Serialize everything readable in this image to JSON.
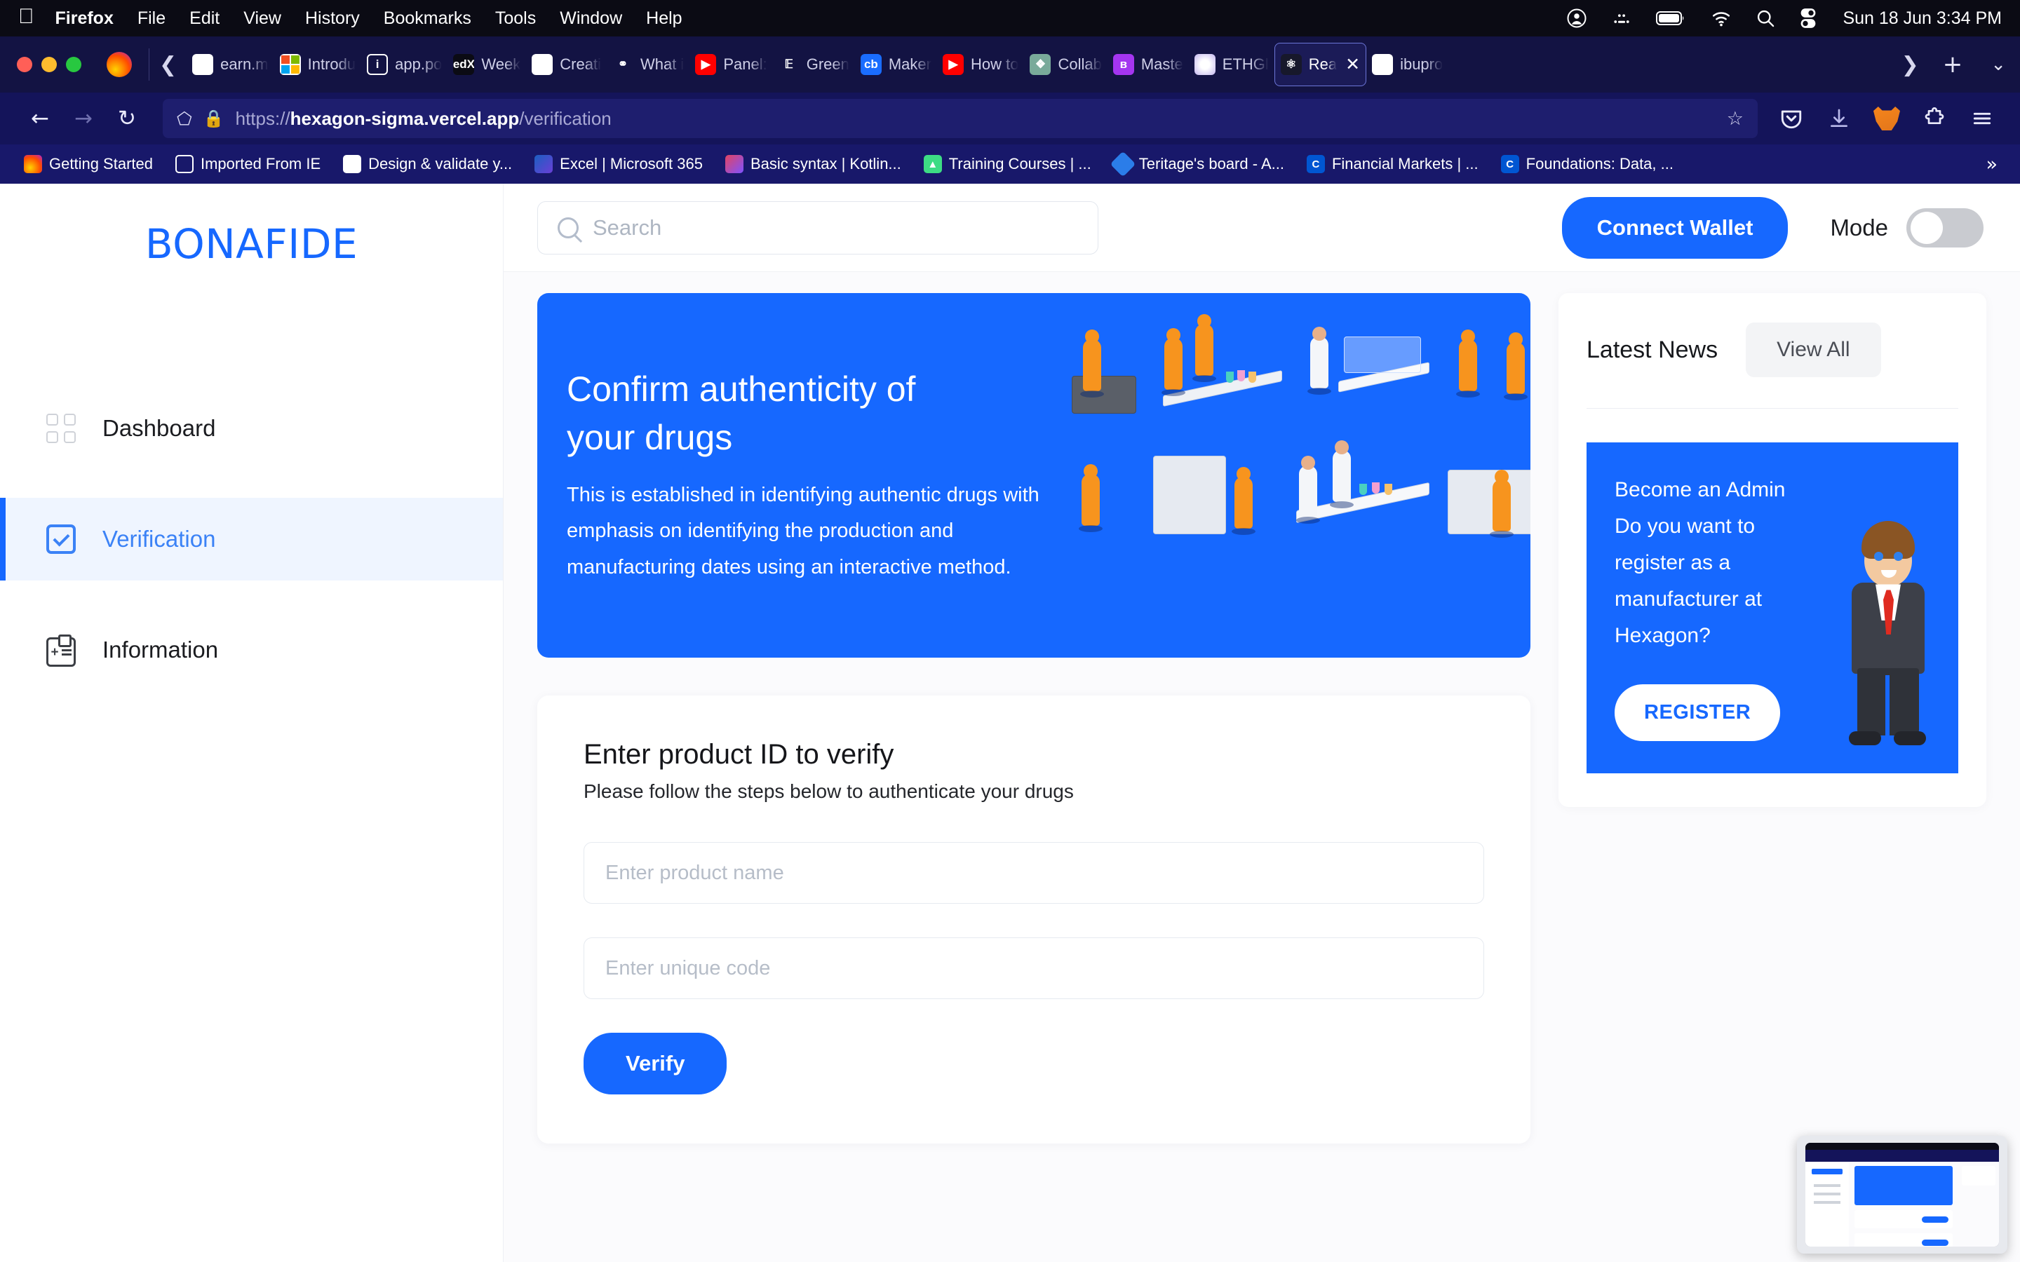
{
  "menubar": {
    "apple_icon": "apple-icon",
    "items": [
      "Firefox",
      "File",
      "Edit",
      "View",
      "History",
      "Bookmarks",
      "Tools",
      "Window",
      "Help"
    ],
    "status_icons": [
      "control-center-user-icon",
      "bluetooth-dots-icon",
      "battery-icon",
      "wifi-icon",
      "search-icon",
      "control-center-icon"
    ],
    "clock": "Sun 18 Jun  3:34 PM"
  },
  "browser": {
    "tabs": [
      {
        "label": "earn.m",
        "favicon": "generic-icon",
        "active": false
      },
      {
        "label": "Introdu",
        "favicon": "microsoft-icon",
        "active": false
      },
      {
        "label": "app.po",
        "favicon": "info-icon",
        "active": false
      },
      {
        "label": "Week",
        "favicon": "edx-icon",
        "active": false
      },
      {
        "label": "Creati",
        "favicon": "zoom-z-icon",
        "active": false
      },
      {
        "label": "What i",
        "favicon": "spiral-icon",
        "active": false
      },
      {
        "label": "Panel:",
        "favicon": "youtube-icon",
        "active": false
      },
      {
        "label": "Green",
        "favicon": "green-g-icon",
        "active": false
      },
      {
        "label": "Maker",
        "favicon": "cb-icon",
        "active": false
      },
      {
        "label": "How to",
        "favicon": "youtube-icon",
        "active": false
      },
      {
        "label": "Collab",
        "favicon": "openai-icon",
        "active": false
      },
      {
        "label": "Maste",
        "favicon": "udemy-icon",
        "active": false
      },
      {
        "label": "ETHGl",
        "favicon": "ethglobal-icon",
        "active": false
      },
      {
        "label": "Rea",
        "favicon": "react-icon",
        "active": true
      },
      {
        "label": "ibupro",
        "favicon": "google-icon",
        "active": false
      }
    ],
    "tab_scroll_left_icon": "chevron-left-icon",
    "tab_scroll_right_icon": "chevron-right-icon",
    "new_tab_icon": "plus-icon",
    "list_all_tabs_icon": "chevron-down-icon",
    "close_tab_icon": "close-icon",
    "nav": {
      "back_icon": "back-arrow-icon",
      "forward_icon": "forward-arrow-icon",
      "reload_icon": "reload-icon",
      "shield_icon": "shield-icon",
      "lock_icon": "padlock-icon",
      "bookmark_star_icon": "star-icon",
      "url_scheme": "https://",
      "url_host": "hexagon-sigma.vercel.app",
      "url_path": "/verification"
    },
    "toolbar_icons": [
      "pocket-icon",
      "downloads-icon",
      "metamask-icon",
      "extensions-icon",
      "hamburger-menu-icon"
    ],
    "bookmarks": [
      {
        "label": "Getting Started",
        "icon": "firefox-icon"
      },
      {
        "label": "Imported From IE",
        "icon": "folder-icon"
      },
      {
        "label": "Design & validate y...",
        "icon": "grammarly-icon"
      },
      {
        "label": "Excel | Microsoft 365",
        "icon": "excel-icon"
      },
      {
        "label": "Basic syntax | Kotlin...",
        "icon": "kotlin-icon"
      },
      {
        "label": "Training Courses  |  ...",
        "icon": "android-icon"
      },
      {
        "label": "Teritage's board - A...",
        "icon": "teritage-icon"
      },
      {
        "label": "Financial Markets | ...",
        "icon": "coursera-icon"
      },
      {
        "label": "Foundations: Data, ...",
        "icon": "coursera-icon"
      }
    ],
    "bookmarks_overflow_icon": "double-chevron-right-icon"
  },
  "app": {
    "logo": "BONAFIDE",
    "sidebar": {
      "items": [
        {
          "label": "Dashboard",
          "icon": "grid-icon",
          "active": false
        },
        {
          "label": "Verification",
          "icon": "checkbox-icon",
          "active": true
        },
        {
          "label": "Information",
          "icon": "id-card-icon",
          "active": false
        }
      ]
    },
    "topbar": {
      "search_placeholder": "Search",
      "search_value": "",
      "search_icon": "search-icon",
      "connect_wallet_label": "Connect Wallet",
      "mode_label": "Mode",
      "mode_on": false
    },
    "hero": {
      "title_line1": "Confirm authenticity of",
      "title_line2": "your drugs",
      "body": "This is established in identifying authentic drugs with emphasis on identifying the production and manufacturing dates using an interactive method.",
      "illustration": "isometric-laboratory-scene",
      "bg_color": "#1668ff"
    },
    "form": {
      "title": "Enter product ID to verify",
      "subtitle": "Please follow the steps below to authenticate your drugs",
      "product_name_placeholder": "Enter product name",
      "product_name_value": "",
      "unique_code_placeholder": "Enter unique code",
      "unique_code_value": "",
      "verify_label": "Verify"
    },
    "news": {
      "heading": "Latest News",
      "view_all_label": "View All",
      "card": {
        "line1": "Become an Admin",
        "line2": "Do you want to register as a manufacturer at Hexagon?",
        "register_label": "REGISTER",
        "illustration": "businessman-cartoon-icon",
        "bg_color": "#1668ff"
      }
    }
  },
  "pip": {
    "label": "picture-in-picture-preview"
  }
}
